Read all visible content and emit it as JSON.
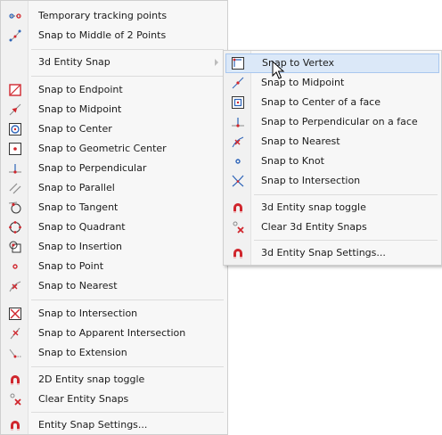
{
  "main_menu": {
    "items": [
      {
        "label": "Temporary tracking points",
        "icon": "tracking-points-icon"
      },
      {
        "label": "Snap to Middle of 2 Points",
        "icon": "midpoint-two-points-icon"
      },
      {
        "label": "3d Entity Snap",
        "icon": "none",
        "submenu": true
      },
      {
        "label": "Snap to Endpoint",
        "icon": "endpoint-icon"
      },
      {
        "label": "Snap to Midpoint",
        "icon": "midpoint-icon"
      },
      {
        "label": "Snap to Center",
        "icon": "center-icon"
      },
      {
        "label": "Snap to Geometric Center",
        "icon": "geometric-center-icon"
      },
      {
        "label": "Snap to Perpendicular",
        "icon": "perpendicular-icon"
      },
      {
        "label": "Snap to Parallel",
        "icon": "parallel-icon"
      },
      {
        "label": "Snap to Tangent",
        "icon": "tangent-icon"
      },
      {
        "label": "Snap to Quadrant",
        "icon": "quadrant-icon"
      },
      {
        "label": "Snap to Insertion",
        "icon": "insertion-icon"
      },
      {
        "label": "Snap to Point",
        "icon": "point-icon"
      },
      {
        "label": "Snap to Nearest",
        "icon": "nearest-icon"
      },
      {
        "label": "Snap to Intersection",
        "icon": "intersection-icon"
      },
      {
        "label": "Snap to Apparent Intersection",
        "icon": "apparent-intersection-icon"
      },
      {
        "label": "Snap to Extension",
        "icon": "extension-icon"
      },
      {
        "label": "2D Entity snap toggle",
        "icon": "magnet-icon"
      },
      {
        "label": "Clear Entity Snaps",
        "icon": "clear-snaps-icon"
      },
      {
        "label": "Entity Snap Settings...",
        "icon": "magnet-icon"
      }
    ]
  },
  "sub_menu": {
    "items": [
      {
        "label": "Snap to Vertex",
        "icon": "vertex-icon",
        "highlighted": true
      },
      {
        "label": "Snap to Midpoint",
        "icon": "midpoint-icon"
      },
      {
        "label": "Snap to Center of a face",
        "icon": "face-center-icon"
      },
      {
        "label": "Snap to Perpendicular on a face",
        "icon": "perpendicular-icon"
      },
      {
        "label": "Snap to Nearest",
        "icon": "nearest-icon"
      },
      {
        "label": "Snap to Knot",
        "icon": "knot-icon"
      },
      {
        "label": "Snap to Intersection",
        "icon": "intersection-icon"
      },
      {
        "label": "3d Entity snap toggle",
        "icon": "magnet-icon"
      },
      {
        "label": "Clear 3d Entity Snaps",
        "icon": "clear-snaps-icon"
      },
      {
        "label": "3d Entity Snap Settings...",
        "icon": "magnet-icon"
      }
    ]
  },
  "colors": {
    "menu_bg": "#f7f7f7",
    "highlight_bg": "#dbe8f8",
    "highlight_border": "#a9c7ef",
    "icon_red": "#d0262d",
    "icon_blue": "#2c63b8"
  }
}
